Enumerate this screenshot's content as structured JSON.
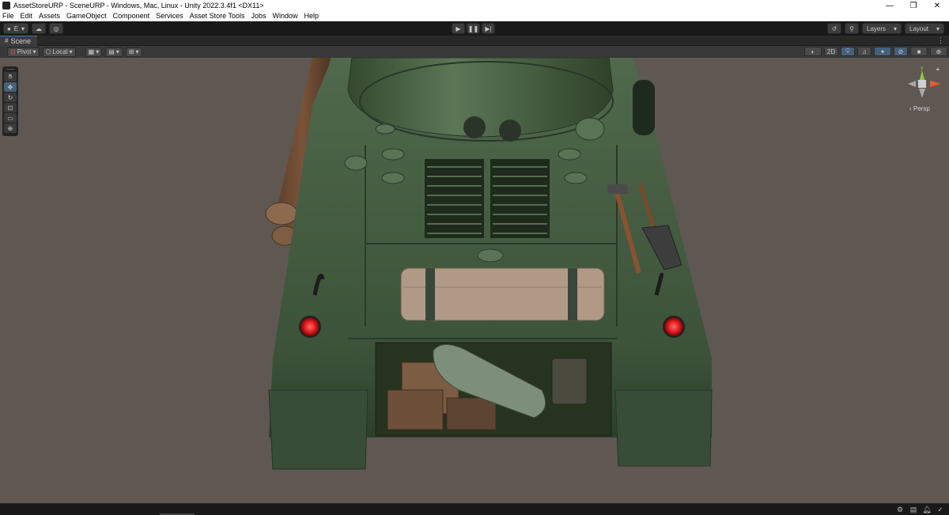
{
  "window": {
    "title": "AssetStoreURP - SceneURP - Windows, Mac, Linux - Unity 2022.3.4f1 <DX11>",
    "minimize": "—",
    "restore": "❐",
    "close": "✕"
  },
  "menu": [
    "File",
    "Edit",
    "Assets",
    "GameObject",
    "Component",
    "Services",
    "Asset Store Tools",
    "Jobs",
    "Window",
    "Help"
  ],
  "toolbar": {
    "account_label": "E",
    "play": "▶",
    "pause": "❚❚",
    "step": "▶|",
    "layers_label": "Layers",
    "layout_label": "Layout"
  },
  "scene_tab": {
    "icon": "#",
    "label": "Scene"
  },
  "scene_toolbar": {
    "pivot_label": "Pivot",
    "local_label": "Local",
    "mode_2d_label": "2D"
  },
  "gizmo": {
    "projection_label": "‹ Persp",
    "y_axis_label": "y"
  },
  "colors": {
    "accent": "#46607c",
    "viewport_bg": "#5f5752",
    "tank_green": "#3f5a3c",
    "gizmo_x": "#e35a3a",
    "gizmo_y": "#8ec63f",
    "gizmo_z": "#3a79bb"
  },
  "icons": {
    "tools": [
      "hand-icon",
      "move-icon",
      "rotate-icon",
      "scale-icon",
      "rect-icon",
      "transform-icon"
    ],
    "status": [
      "debug-icon",
      "cache-icon",
      "bell-icon",
      "check-icon"
    ]
  }
}
